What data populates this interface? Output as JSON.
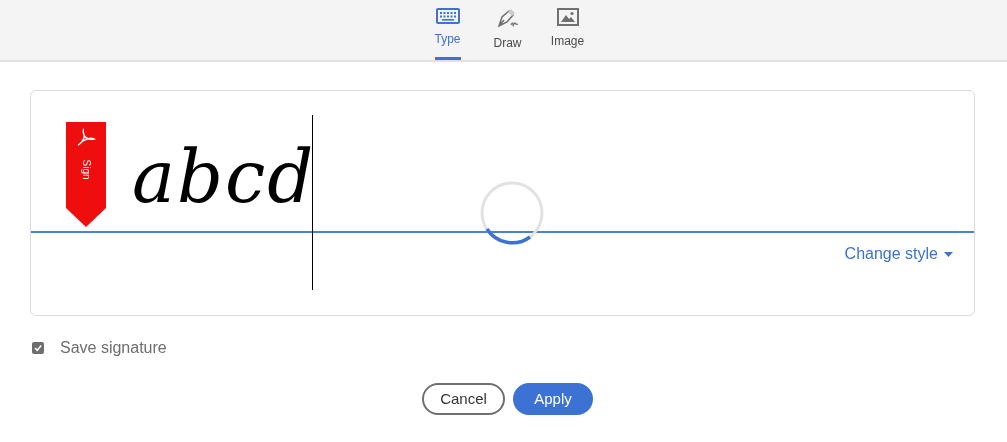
{
  "tabs": [
    {
      "label": "Type",
      "selected": true
    },
    {
      "label": "Draw",
      "selected": false
    },
    {
      "label": "Image",
      "selected": false
    }
  ],
  "signature": {
    "badge": "Sign",
    "text": "abcd",
    "change_style": "Change style"
  },
  "save_signature": {
    "label": "Save signature",
    "checked": true
  },
  "buttons": [
    {
      "label": "Cancel",
      "kind": "secondary"
    },
    {
      "label": "Apply",
      "kind": "primary"
    }
  ]
}
